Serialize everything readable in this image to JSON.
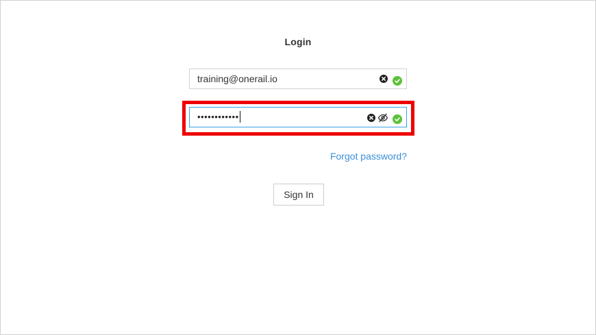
{
  "login": {
    "title": "Login",
    "email": {
      "value": "training@onerail.io",
      "clear_icon": "clear-circle-icon",
      "valid_icon": "check-circle-icon"
    },
    "password": {
      "masked_value": "••••••••••••",
      "clear_icon": "clear-circle-icon",
      "visibility_icon": "eye-slash-icon",
      "valid_icon": "check-circle-icon"
    },
    "forgot_password": "Forgot password?",
    "sign_in": "Sign In"
  },
  "colors": {
    "valid_green": "#5cc23a",
    "link_blue": "#3a8fd8",
    "focus_border": "#3aa0e6",
    "highlight_red": "#ee0000"
  }
}
